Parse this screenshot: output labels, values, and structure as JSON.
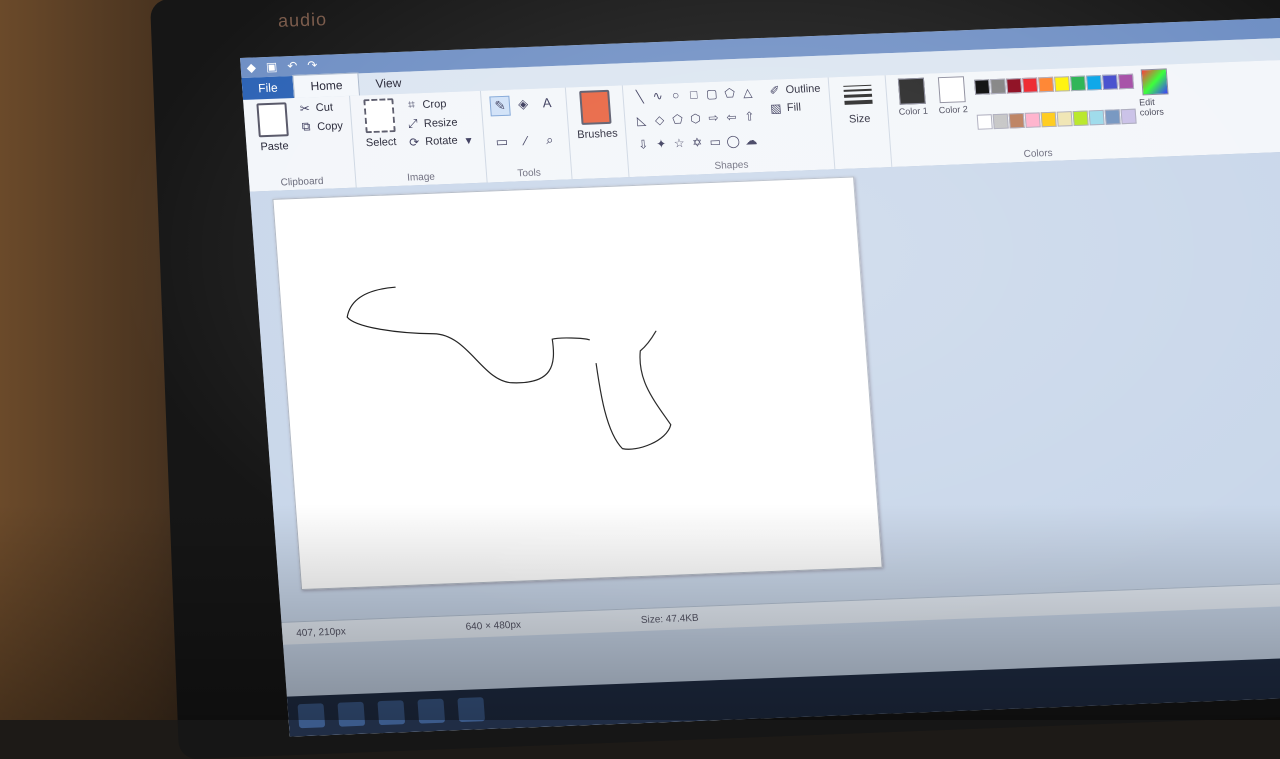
{
  "brand": "audio",
  "tabs": {
    "file": "File",
    "home": "Home",
    "view": "View"
  },
  "clipboard": {
    "paste": "Paste",
    "cut": "Cut",
    "copy": "Copy",
    "label": "Clipboard"
  },
  "image": {
    "select": "Select",
    "crop": "Crop",
    "resize": "Resize",
    "rotate": "Rotate",
    "label": "Image"
  },
  "tools": {
    "label": "Tools",
    "text_tool": "A"
  },
  "brushes": {
    "label": "Brushes"
  },
  "shapes": {
    "label": "Shapes",
    "outline": "Outline",
    "fill": "Fill"
  },
  "size": {
    "label": "Size"
  },
  "colors": {
    "color1": "Color 1",
    "color2": "Color 2",
    "edit": "Edit colors",
    "label": "Colors",
    "color1_value": "#222222",
    "color2_value": "#ffffff",
    "palette": [
      "#000000",
      "#7f7f7f",
      "#880015",
      "#ed1c24",
      "#ff7f27",
      "#fff200",
      "#22b14c",
      "#00a2e8",
      "#3f48cc",
      "#a349a4",
      "#ffffff",
      "#c3c3c3",
      "#b97a57",
      "#ffaec9",
      "#ffc90e",
      "#efe4b0",
      "#b5e61d",
      "#99d9ea",
      "#7092be",
      "#c8bfe7"
    ]
  },
  "status": {
    "position": "407, 210px",
    "canvas_size": "640 × 480px",
    "file_size": "Size: 47.4KB"
  }
}
